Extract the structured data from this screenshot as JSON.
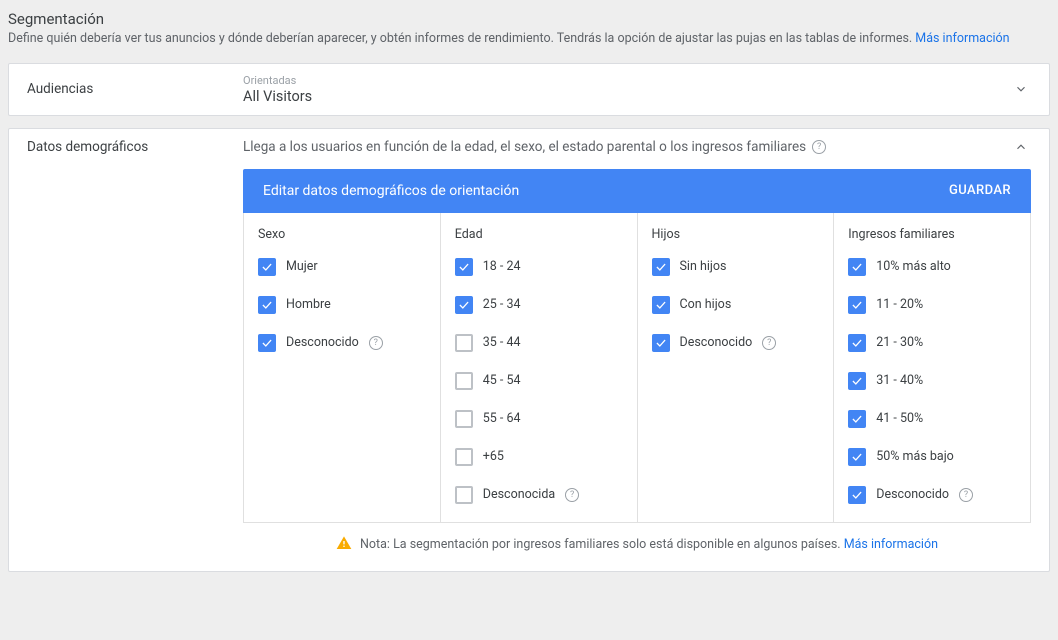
{
  "header": {
    "title": "Segmentación",
    "description": "Define quién debería ver tus anuncios y dónde deberían aparecer, y obtén informes de rendimiento. Tendrás la opción de ajustar las pujas en las tablas de informes. ",
    "more_info": "Más información"
  },
  "audiences": {
    "label": "Audiencias",
    "sublabel": "Orientadas",
    "value": "All Visitors"
  },
  "demographics": {
    "label": "Datos demográficos",
    "description": "Llega a los usuarios en función de la edad, el sexo, el estado parental o los ingresos familiares",
    "editor_title": "Editar datos demográficos de orientación",
    "save_label": "GUARDAR",
    "columns": [
      {
        "header": "Sexo",
        "options": [
          {
            "label": "Mujer",
            "checked": true,
            "help": false
          },
          {
            "label": "Hombre",
            "checked": true,
            "help": false
          },
          {
            "label": "Desconocido",
            "checked": true,
            "help": true
          }
        ]
      },
      {
        "header": "Edad",
        "options": [
          {
            "label": "18 - 24",
            "checked": true,
            "help": false
          },
          {
            "label": "25 - 34",
            "checked": true,
            "help": false
          },
          {
            "label": "35 - 44",
            "checked": false,
            "help": false
          },
          {
            "label": "45 - 54",
            "checked": false,
            "help": false
          },
          {
            "label": "55 - 64",
            "checked": false,
            "help": false
          },
          {
            "label": "+65",
            "checked": false,
            "help": false
          },
          {
            "label": "Desconocida",
            "checked": false,
            "help": true
          }
        ]
      },
      {
        "header": "Hijos",
        "options": [
          {
            "label": "Sin hijos",
            "checked": true,
            "help": false
          },
          {
            "label": "Con hijos",
            "checked": true,
            "help": false
          },
          {
            "label": "Desconocido",
            "checked": true,
            "help": true
          }
        ]
      },
      {
        "header": "Ingresos familiares",
        "options": [
          {
            "label": "10% más alto",
            "checked": true,
            "help": false
          },
          {
            "label": "11 - 20%",
            "checked": true,
            "help": false
          },
          {
            "label": "21 - 30%",
            "checked": true,
            "help": false
          },
          {
            "label": "31 - 40%",
            "checked": true,
            "help": false
          },
          {
            "label": "41 - 50%",
            "checked": true,
            "help": false
          },
          {
            "label": "50% más bajo",
            "checked": true,
            "help": false
          },
          {
            "label": "Desconocido",
            "checked": true,
            "help": true
          }
        ]
      }
    ]
  },
  "note": {
    "prefix": "Nota: ",
    "text": "La segmentación por ingresos familiares solo está disponible en algunos países. ",
    "link": "Más información"
  }
}
